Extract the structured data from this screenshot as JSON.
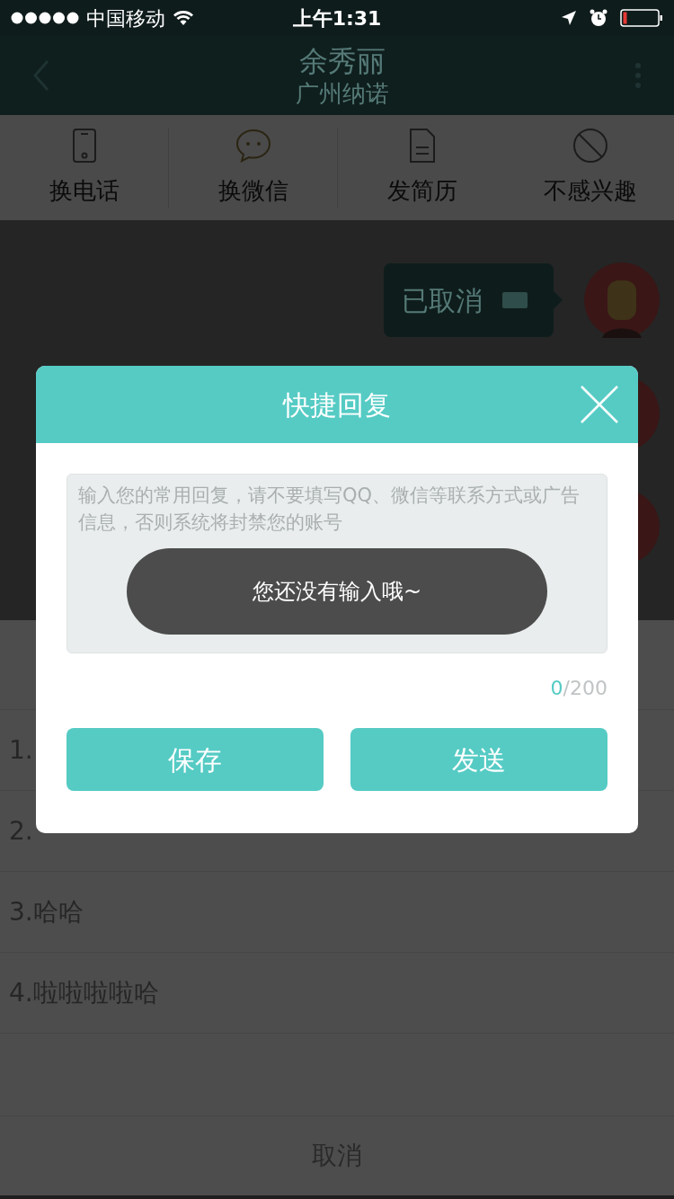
{
  "status_bar": {
    "carrier": "中国移动",
    "time": "上午1:31"
  },
  "header": {
    "title": "余秀丽",
    "subtitle": "广州纳诺"
  },
  "actions": [
    {
      "label": "换电话",
      "kind": "phone"
    },
    {
      "label": "换微信",
      "kind": "chat"
    },
    {
      "label": "发简历",
      "kind": "document"
    },
    {
      "label": "不感兴趣",
      "kind": "block"
    }
  ],
  "chat": {
    "messages": [
      {
        "text": "已取消"
      }
    ]
  },
  "reply_sheet": {
    "items": [
      "1.",
      "2.",
      "3.哈哈",
      "4.啦啦啦啦哈"
    ],
    "cancel": "取消"
  },
  "dialog": {
    "title": "快捷回复",
    "placeholder": "输入您的常用回复，请不要填写QQ、微信等联系方式或广告信息，否则系统将封禁您的账号",
    "count": "0",
    "limit": "/200",
    "buttons": [
      "保存",
      "发送"
    ]
  },
  "toast": "您还没有输入哦~"
}
